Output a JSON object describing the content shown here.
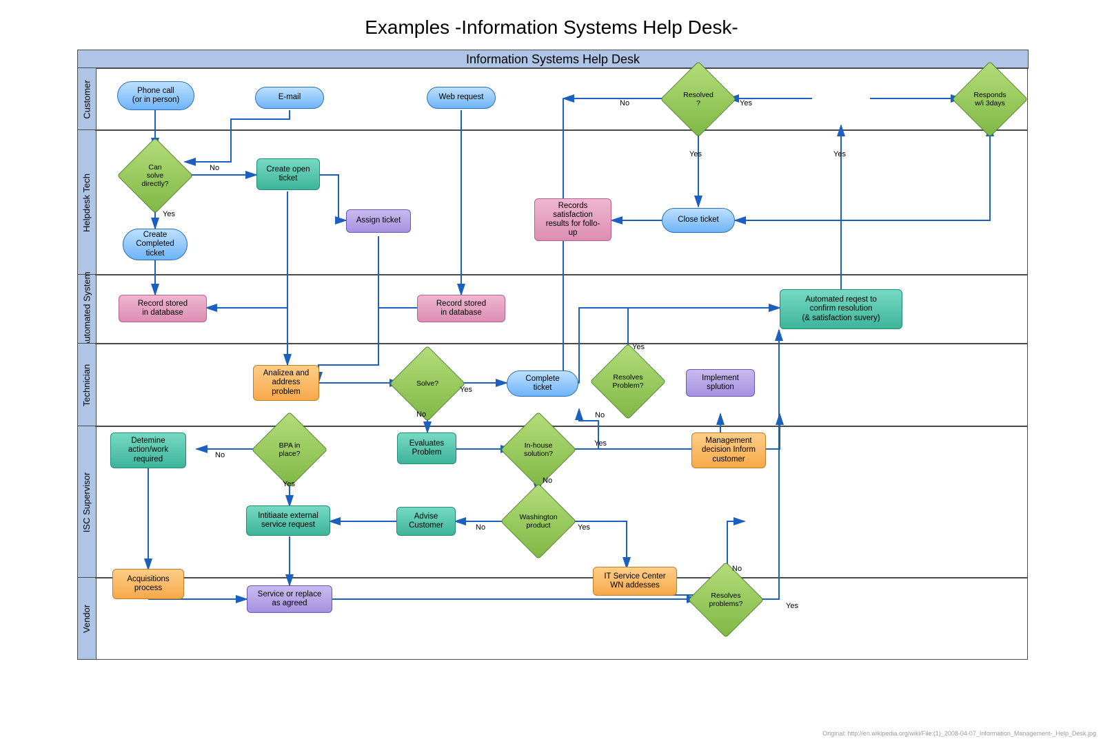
{
  "chart_data": {
    "type": "flowchart",
    "title": "Examples -Information Systems Help Desk-",
    "pool": "Information Systems Help Desk",
    "lanes": [
      "Customer",
      "Helpdesk Tech",
      "Automated System",
      "Technician",
      "ISC Supervisor",
      "Vendor"
    ],
    "nodes": [
      {
        "id": "phone",
        "lane": "Customer",
        "type": "start",
        "label": "Phone call (or in person)"
      },
      {
        "id": "email",
        "lane": "Customer",
        "type": "start",
        "label": "E-mail"
      },
      {
        "id": "web",
        "lane": "Customer",
        "type": "start",
        "label": "Web request"
      },
      {
        "id": "resolved",
        "lane": "Customer",
        "type": "decision",
        "label": "Resolved ?"
      },
      {
        "id": "responds",
        "lane": "Customer",
        "type": "decision",
        "label": "Responds w/i 3days"
      },
      {
        "id": "cansolve",
        "lane": "Helpdesk Tech",
        "type": "decision",
        "label": "Can solve directly?"
      },
      {
        "id": "createopen",
        "lane": "Helpdesk Tech",
        "type": "process",
        "label": "Create open ticket"
      },
      {
        "id": "assign",
        "lane": "Helpdesk Tech",
        "type": "process",
        "label": "Assign ticket"
      },
      {
        "id": "createcomp",
        "lane": "Helpdesk Tech",
        "type": "terminator",
        "label": "Create Completed ticket"
      },
      {
        "id": "satisf",
        "lane": "Helpdesk Tech",
        "type": "process",
        "label": "Records satisfaction results for follo-up"
      },
      {
        "id": "close",
        "lane": "Helpdesk Tech",
        "type": "terminator",
        "label": "Close ticket"
      },
      {
        "id": "record1",
        "lane": "Automated System",
        "type": "process",
        "label": "Record stored in database"
      },
      {
        "id": "record2",
        "lane": "Automated System",
        "type": "process",
        "label": "Record stored in database"
      },
      {
        "id": "autoreq",
        "lane": "Automated System",
        "type": "process",
        "label": "Automated reqest to confirm resolution (& satisfaction suvery)"
      },
      {
        "id": "analize",
        "lane": "Technician",
        "type": "process",
        "label": "Analizea and address problem"
      },
      {
        "id": "solve",
        "lane": "Technician",
        "type": "decision",
        "label": "Solve?"
      },
      {
        "id": "compticket",
        "lane": "Technician",
        "type": "terminator",
        "label": "Complete ticket"
      },
      {
        "id": "resolvesprob",
        "lane": "Technician",
        "type": "decision",
        "label": "Resolves Problem?"
      },
      {
        "id": "implement",
        "lane": "Technician",
        "type": "process",
        "label": "Implement splution"
      },
      {
        "id": "determine",
        "lane": "ISC Supervisor",
        "type": "process",
        "label": "Detemine action/work required"
      },
      {
        "id": "bpa",
        "lane": "ISC Supervisor",
        "type": "decision",
        "label": "BPA in place?"
      },
      {
        "id": "evaluates",
        "lane": "ISC Supervisor",
        "type": "process",
        "label": "Evaluates Problem"
      },
      {
        "id": "inhouse",
        "lane": "ISC Supervisor",
        "type": "decision",
        "label": "In-house solution?"
      },
      {
        "id": "initiate",
        "lane": "ISC Supervisor",
        "type": "process",
        "label": "Intitiaate external service request"
      },
      {
        "id": "advise",
        "lane": "ISC Supervisor",
        "type": "process",
        "label": "Advise Customer"
      },
      {
        "id": "washington",
        "lane": "ISC Supervisor",
        "type": "decision",
        "label": "Washington product"
      },
      {
        "id": "mgmt",
        "lane": "ISC Supervisor",
        "type": "process",
        "label": "Management decision Inform customer"
      },
      {
        "id": "acq",
        "lane": "Vendor",
        "type": "process",
        "label": "Acquisitions process"
      },
      {
        "id": "service",
        "lane": "Vendor",
        "type": "process",
        "label": "Service or replace as agreed"
      },
      {
        "id": "itservice",
        "lane": "Vendor",
        "type": "process",
        "label": "IT Service Center WN addesses"
      },
      {
        "id": "resolvesprob2",
        "lane": "Vendor",
        "type": "decision",
        "label": "Resolves problems?"
      }
    ],
    "edges": [
      {
        "from": "phone",
        "to": "cansolve"
      },
      {
        "from": "email",
        "to": "cansolve"
      },
      {
        "from": "cansolve",
        "to": "createopen",
        "label": "No"
      },
      {
        "from": "cansolve",
        "to": "createcomp",
        "label": "Yes"
      },
      {
        "from": "createcomp",
        "to": "record1"
      },
      {
        "from": "createopen",
        "to": "record1"
      },
      {
        "from": "createopen",
        "to": "assign"
      },
      {
        "from": "createopen",
        "to": "analize"
      },
      {
        "from": "web",
        "to": "record2"
      },
      {
        "from": "assign",
        "to": "record2"
      },
      {
        "from": "assign",
        "to": "analize"
      },
      {
        "from": "analize",
        "to": "solve"
      },
      {
        "from": "solve",
        "to": "compticket",
        "label": "Yes"
      },
      {
        "from": "solve",
        "to": "evaluates",
        "label": "No"
      },
      {
        "from": "compticket",
        "to": "autoreq"
      },
      {
        "from": "autoreq",
        "to": "responds"
      },
      {
        "from": "responds",
        "to": "resolved",
        "label": "Yes"
      },
      {
        "from": "responds",
        "to": "close",
        "label": "Yes"
      },
      {
        "from": "resolved",
        "to": "close",
        "label": "Yes"
      },
      {
        "from": "resolved",
        "to": "compticket",
        "label": "No"
      },
      {
        "from": "close",
        "to": "satisf"
      },
      {
        "from": "evaluates",
        "to": "inhouse"
      },
      {
        "from": "inhouse",
        "to": "implement",
        "label": "Yes"
      },
      {
        "from": "inhouse",
        "to": "washington",
        "label": "No"
      },
      {
        "from": "implement",
        "to": "resolvesprob"
      },
      {
        "from": "resolvesprob",
        "to": "autoreq",
        "label": "Yes"
      },
      {
        "from": "resolvesprob",
        "to": "evaluates",
        "label": "No"
      },
      {
        "from": "washington",
        "to": "advise",
        "label": "No"
      },
      {
        "from": "washington",
        "to": "itservice",
        "label": "Yes"
      },
      {
        "from": "advise",
        "to": "initiate"
      },
      {
        "from": "bpa",
        "to": "determine",
        "label": "No"
      },
      {
        "from": "bpa",
        "to": "initiate",
        "label": "Yes"
      },
      {
        "from": "determine",
        "to": "acq"
      },
      {
        "from": "acq",
        "to": "service"
      },
      {
        "from": "initiate",
        "to": "service"
      },
      {
        "from": "itservice",
        "to": "resolvesprob2"
      },
      {
        "from": "service",
        "to": "resolvesprob2"
      },
      {
        "from": "resolvesprob2",
        "to": "autoreq",
        "label": "Yes"
      },
      {
        "from": "resolvesprob2",
        "to": "mgmt",
        "label": "No"
      }
    ]
  },
  "title": "Examples -Information Systems Help Desk-",
  "pool": "Information Systems Help Desk",
  "lanes": {
    "l1": "Customer",
    "l2": "Helpdesk Tech",
    "l3": "Automated System",
    "l4": "Technician",
    "l5": "ISC Supervisor",
    "l6": "Vendor"
  },
  "nodes": {
    "phone": "Phone call\n(or in person)",
    "email": "E-mail",
    "web": "Web request",
    "resolved": "Resolved\n?",
    "responds": "Responds\nw/i 3days",
    "cansolve": "Can\nsolve\ndirectly?",
    "createopen": "Create open\nticket",
    "assign": "Assign ticket",
    "createcomp": "Create\nCompleted\nticket",
    "satisf": "Records\nsatisfaction\nresults for follo-\nup",
    "close": "Close ticket",
    "record1": "Record stored\nin database",
    "record2": "Record stored\nin database",
    "autoreq": "Automated reqest to\nconfirm resolution\n(& satisfaction suvery)",
    "analize": "Analizea and\naddress\nproblem",
    "solve": "Solve?",
    "compticket": "Complete\nticket",
    "resolvesprob": "Resolves\nProblem?",
    "implement": "Implement\nsplution",
    "determine": "Detemine\naction/work\nrequired",
    "bpa": "BPA in\nplace?",
    "evaluates": "Evaluates\nProblem",
    "inhouse": "In-house\nsolution?",
    "initiate": "Intitiaate external\nservice request",
    "advise": "Advise\nCustomer",
    "washington": "Washington\nproduct",
    "mgmt": "Management\ndecision Inform\ncustomer",
    "acq": "Acquisitions\nprocess",
    "service": "Service or replace\nas agreed",
    "itservice": "IT Service Center\nWN addesses",
    "resolvesprob2": "Resolves\nproblems?"
  },
  "labels": {
    "yes": "Yes",
    "no": "No"
  },
  "credit": "Original: http://en.wikipedia.org/wiki/File:(1)_2008-04-07_Information_Management-_Help_Desk.jpg"
}
